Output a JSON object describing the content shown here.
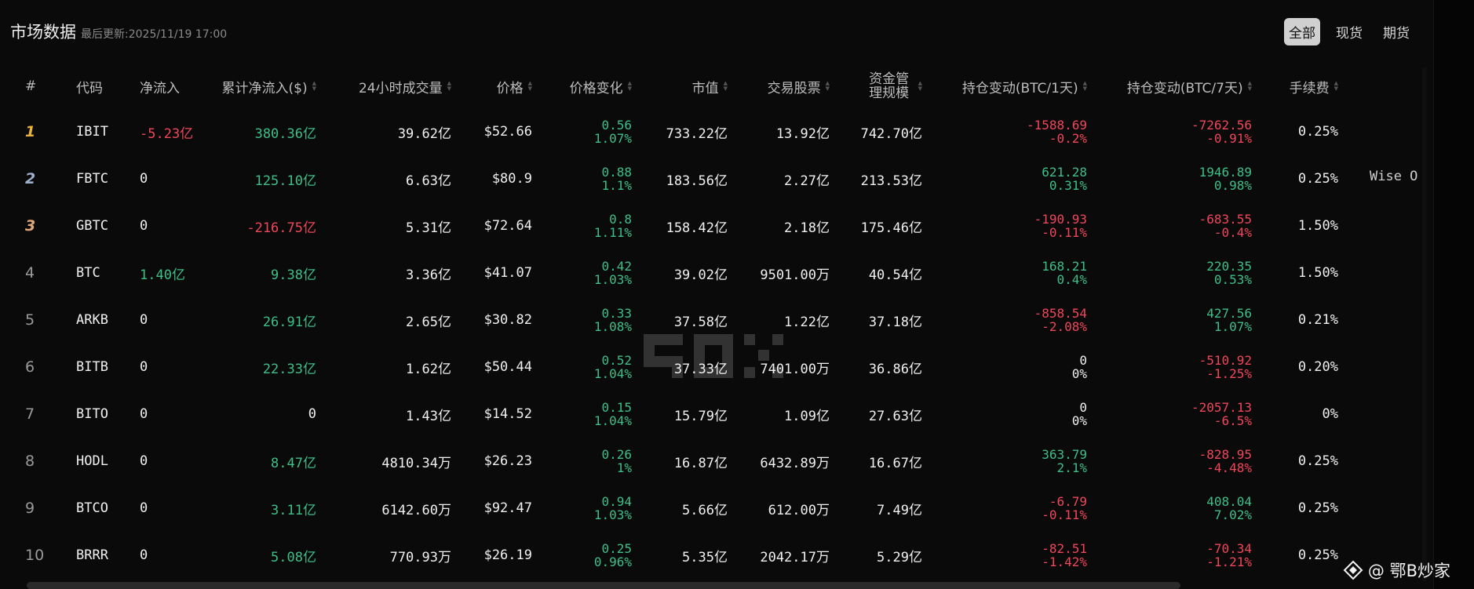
{
  "header": {
    "title": "市场数据",
    "updated": "最后更新:2025/11/19 17:00",
    "tabs": [
      "全部",
      "现货",
      "期货"
    ],
    "active_tab": 0
  },
  "columns": [
    {
      "label": "#",
      "sortable": false
    },
    {
      "label": "代码",
      "sortable": false
    },
    {
      "label": "净流入",
      "sortable": false
    },
    {
      "label": "累计净流入($)",
      "sortable": true
    },
    {
      "label": "24小时成交量",
      "sortable": true
    },
    {
      "label": "价格",
      "sortable": true
    },
    {
      "label": "价格变化",
      "sortable": true
    },
    {
      "label": "市值",
      "sortable": true
    },
    {
      "label": "交易股票",
      "sortable": true
    },
    {
      "label": "资金管理规模",
      "sortable": true
    },
    {
      "label": "持仓变动(BTC/1天)",
      "sortable": true
    },
    {
      "label": "持仓变动(BTC/7天)",
      "sortable": true
    },
    {
      "label": "手续费",
      "sortable": true
    }
  ],
  "rows": [
    {
      "rank": "1",
      "code": "IBIT",
      "inflow": "-5.23亿",
      "inflow_c": "neg",
      "cum": "380.36亿",
      "cum_c": "pos",
      "vol": "39.62亿",
      "price": "$52.66",
      "chg": "0.56",
      "chg_pct": "1.07%",
      "cap": "733.22亿",
      "shares": "13.92亿",
      "aum": "742.70亿",
      "d1": "-1588.69",
      "d1_pct": "-0.2%",
      "d1_c": "neg",
      "d7": "-7262.56",
      "d7_pct": "-0.91%",
      "d7_c": "neg",
      "fee": "0.25%"
    },
    {
      "rank": "2",
      "code": "FBTC",
      "inflow": "0",
      "inflow_c": "neu",
      "cum": "125.10亿",
      "cum_c": "pos",
      "vol": "6.63亿",
      "price": "$80.9",
      "chg": "0.88",
      "chg_pct": "1.1%",
      "cap": "183.56亿",
      "shares": "2.27亿",
      "aum": "213.53亿",
      "d1": "621.28",
      "d1_pct": "0.31%",
      "d1_c": "pos",
      "d7": "1946.89",
      "d7_pct": "0.98%",
      "d7_c": "pos",
      "fee": "0.25%"
    },
    {
      "rank": "3",
      "code": "GBTC",
      "inflow": "0",
      "inflow_c": "neu",
      "cum": "-216.75亿",
      "cum_c": "neg",
      "vol": "5.31亿",
      "price": "$72.64",
      "chg": "0.8",
      "chg_pct": "1.11%",
      "cap": "158.42亿",
      "shares": "2.18亿",
      "aum": "175.46亿",
      "d1": "-190.93",
      "d1_pct": "-0.11%",
      "d1_c": "neg",
      "d7": "-683.55",
      "d7_pct": "-0.4%",
      "d7_c": "neg",
      "fee": "1.50%"
    },
    {
      "rank": "4",
      "code": "BTC",
      "inflow": "1.40亿",
      "inflow_c": "pos",
      "cum": "9.38亿",
      "cum_c": "pos",
      "vol": "3.36亿",
      "price": "$41.07",
      "chg": "0.42",
      "chg_pct": "1.03%",
      "cap": "39.02亿",
      "shares": "9501.00万",
      "aum": "40.54亿",
      "d1": "168.21",
      "d1_pct": "0.4%",
      "d1_c": "pos",
      "d7": "220.35",
      "d7_pct": "0.53%",
      "d7_c": "pos",
      "fee": "1.50%"
    },
    {
      "rank": "5",
      "code": "ARKB",
      "inflow": "0",
      "inflow_c": "neu",
      "cum": "26.91亿",
      "cum_c": "pos",
      "vol": "2.65亿",
      "price": "$30.82",
      "chg": "0.33",
      "chg_pct": "1.08%",
      "cap": "37.58亿",
      "shares": "1.22亿",
      "aum": "37.18亿",
      "d1": "-858.54",
      "d1_pct": "-2.08%",
      "d1_c": "neg",
      "d7": "427.56",
      "d7_pct": "1.07%",
      "d7_c": "pos",
      "fee": "0.21%"
    },
    {
      "rank": "6",
      "code": "BITB",
      "inflow": "0",
      "inflow_c": "neu",
      "cum": "22.33亿",
      "cum_c": "pos",
      "vol": "1.62亿",
      "price": "$50.44",
      "chg": "0.52",
      "chg_pct": "1.04%",
      "cap": "37.33亿",
      "shares": "7401.00万",
      "aum": "36.86亿",
      "d1": "0",
      "d1_pct": "0%",
      "d1_c": "neu",
      "d7": "-510.92",
      "d7_pct": "-1.25%",
      "d7_c": "neg",
      "fee": "0.20%"
    },
    {
      "rank": "7",
      "code": "BITO",
      "inflow": "0",
      "inflow_c": "neu",
      "cum": "0",
      "cum_c": "neu",
      "vol": "1.43亿",
      "price": "$14.52",
      "chg": "0.15",
      "chg_pct": "1.04%",
      "cap": "15.79亿",
      "shares": "1.09亿",
      "aum": "27.63亿",
      "d1": "0",
      "d1_pct": "0%",
      "d1_c": "neu",
      "d7": "-2057.13",
      "d7_pct": "-6.5%",
      "d7_c": "neg",
      "fee": "0%"
    },
    {
      "rank": "8",
      "code": "HODL",
      "inflow": "0",
      "inflow_c": "neu",
      "cum": "8.47亿",
      "cum_c": "pos",
      "vol": "4810.34万",
      "price": "$26.23",
      "chg": "0.26",
      "chg_pct": "1%",
      "cap": "16.87亿",
      "shares": "6432.89万",
      "aum": "16.67亿",
      "d1": "363.79",
      "d1_pct": "2.1%",
      "d1_c": "pos",
      "d7": "-828.95",
      "d7_pct": "-4.48%",
      "d7_c": "neg",
      "fee": "0.25%"
    },
    {
      "rank": "9",
      "code": "BTCO",
      "inflow": "0",
      "inflow_c": "neu",
      "cum": "3.11亿",
      "cum_c": "pos",
      "vol": "6142.60万",
      "price": "$92.47",
      "chg": "0.94",
      "chg_pct": "1.03%",
      "cap": "5.66亿",
      "shares": "612.00万",
      "aum": "7.49亿",
      "d1": "-6.79",
      "d1_pct": "-0.11%",
      "d1_c": "neg",
      "d7": "408.04",
      "d7_pct": "7.02%",
      "d7_c": "pos",
      "fee": "0.25%"
    },
    {
      "rank": "10",
      "code": "BRRR",
      "inflow": "0",
      "inflow_c": "neu",
      "cum": "5.08亿",
      "cum_c": "pos",
      "vol": "770.93万",
      "price": "$26.19",
      "chg": "0.25",
      "chg_pct": "0.96%",
      "cap": "5.35亿",
      "shares": "2042.17万",
      "aum": "5.29亿",
      "d1": "-82.51",
      "d1_pct": "-1.42%",
      "d1_c": "neg",
      "d7": "-70.34",
      "d7_pct": "-1.21%",
      "d7_c": "neg",
      "fee": "0.25%"
    }
  ],
  "overflow_text": "Wise O",
  "brand": {
    "name": "@ 鄂B炒家"
  },
  "colors": {
    "positive": "#3dbf8a",
    "negative": "#f0465a",
    "background": "#0a0a0a"
  }
}
